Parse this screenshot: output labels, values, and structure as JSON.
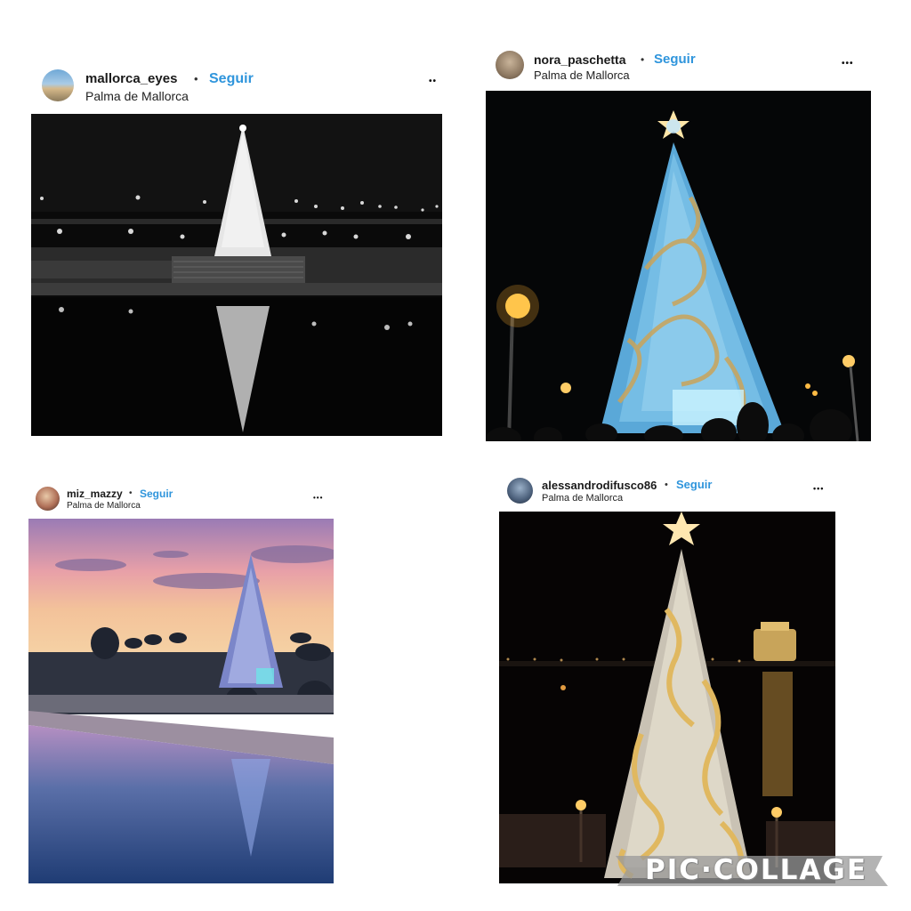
{
  "posts": [
    {
      "username": "mallorca_eyes",
      "separator": "•",
      "follow_label": "Seguir",
      "location": "Palma de Mallorca",
      "more_icon": "more-options-icon"
    },
    {
      "username": "nora_paschetta",
      "separator": "•",
      "follow_label": "Seguir",
      "location": "Palma de Mallorca",
      "more_icon": "more-options-icon"
    },
    {
      "username": "miz_mazzy",
      "separator": "•",
      "follow_label": "Seguir",
      "location": "Palma de Mallorca",
      "more_icon": "more-options-icon"
    },
    {
      "username": "alessandrodifusco86",
      "separator": "•",
      "follow_label": "Seguir",
      "location": "Palma de Mallorca",
      "more_icon": "more-options-icon"
    }
  ],
  "more_glyph": "•••",
  "watermark": "PIC·COLLAGE",
  "colors": {
    "follow": "#2f95dc",
    "background": "#ffffff"
  }
}
